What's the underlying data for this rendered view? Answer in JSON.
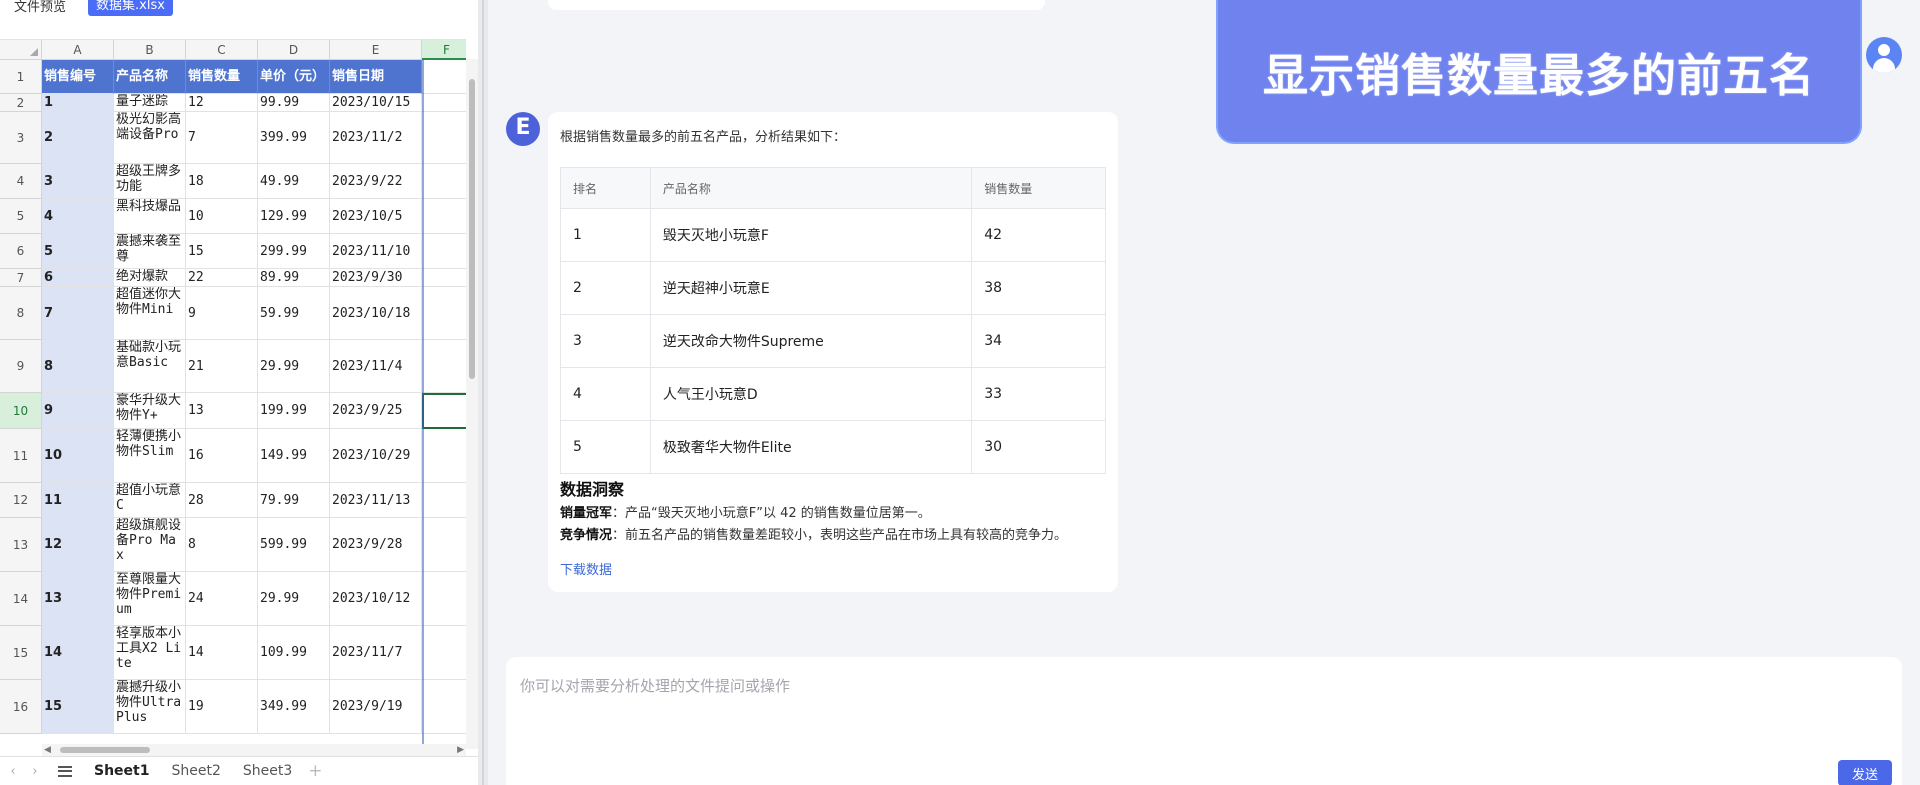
{
  "topbar": {
    "preview_label": "文件预览",
    "file_tab": "数据集.xlsx"
  },
  "sheet": {
    "columns": [
      "A",
      "B",
      "C",
      "D",
      "E",
      "F"
    ],
    "header_row": [
      "销售编号",
      "产品名称",
      "销售数量",
      "单价（元）",
      "销售日期"
    ],
    "rows": [
      [
        "1",
        "量子迷踪",
        "12",
        "99.99",
        "2023/10/15"
      ],
      [
        "2",
        "极光幻影高端设备Pro",
        "7",
        "399.99",
        "2023/11/2"
      ],
      [
        "3",
        "超级王牌多功能",
        "18",
        "49.99",
        "2023/9/22"
      ],
      [
        "4",
        "黑科技爆品",
        "10",
        "129.99",
        "2023/10/5"
      ],
      [
        "5",
        "震撼来袭至尊",
        "15",
        "299.99",
        "2023/11/10"
      ],
      [
        "6",
        "绝对爆款",
        "22",
        "89.99",
        "2023/9/30"
      ],
      [
        "7",
        "超值迷你大物件Mini",
        "9",
        "59.99",
        "2023/10/18"
      ],
      [
        "8",
        "基础款小玩意Basic",
        "21",
        "29.99",
        "2023/11/4"
      ],
      [
        "9",
        "豪华升级大物件Y+",
        "13",
        "199.99",
        "2023/9/25"
      ],
      [
        "10",
        "轻薄便携小物件Slim",
        "16",
        "149.99",
        "2023/10/29"
      ],
      [
        "11",
        "超值小玩意C",
        "28",
        "79.99",
        "2023/11/13"
      ],
      [
        "12",
        "超级旗舰设备Pro Max",
        "8",
        "599.99",
        "2023/9/28"
      ],
      [
        "13",
        "至尊限量大物件Premium",
        "24",
        "29.99",
        "2023/10/12"
      ],
      [
        "14",
        "轻享版本小工具X2 Lite",
        "14",
        "109.99",
        "2023/11/7"
      ],
      [
        "15",
        "震撼升级小物件Ultra Plus",
        "19",
        "349.99",
        "2023/9/19"
      ]
    ],
    "row_numbers": [
      "1",
      "2",
      "3",
      "4",
      "5",
      "6",
      "7",
      "8",
      "9",
      "10",
      "11",
      "12",
      "13",
      "14",
      "15",
      "16"
    ],
    "selected_row": "10",
    "selected_col": "F",
    "tabs": [
      "Sheet1",
      "Sheet2",
      "Sheet3"
    ],
    "active_tab": "Sheet1"
  },
  "chat": {
    "user_message": "显示销售数量最多的前五名",
    "bot_avatar_letter": "E",
    "intro": "根据销售数量最多的前五名产品，分析结果如下：",
    "table_headers": [
      "排名",
      "产品名称",
      "销售数量"
    ],
    "table_rows": [
      [
        "1",
        "毁天灭地小玩意F",
        "42"
      ],
      [
        "2",
        "逆天超神小玩意E",
        "38"
      ],
      [
        "3",
        "逆天改命大物件Supreme",
        "34"
      ],
      [
        "4",
        "人气王小玩意D",
        "33"
      ],
      [
        "5",
        "极致奢华大物件Elite",
        "30"
      ]
    ],
    "insight_title": "数据洞察",
    "insight_1_label": "销量冠军",
    "insight_1_text": "：产品“毁天灭地小玩意F”以 42 的销售数量位居第一。",
    "insight_2_label": "竞争情况",
    "insight_2_text": "：前五名产品的销售数量差距较小，表明这些产品在市场上具有较高的竞争力。",
    "download_label": "下载数据"
  },
  "input": {
    "placeholder": "你可以对需要分析处理的文件提问或操作",
    "send_label": "发送"
  },
  "colors": {
    "accent": "#4a68e8",
    "sheet_header": "#4f74d0",
    "user_bubble": "#6f82ee"
  }
}
